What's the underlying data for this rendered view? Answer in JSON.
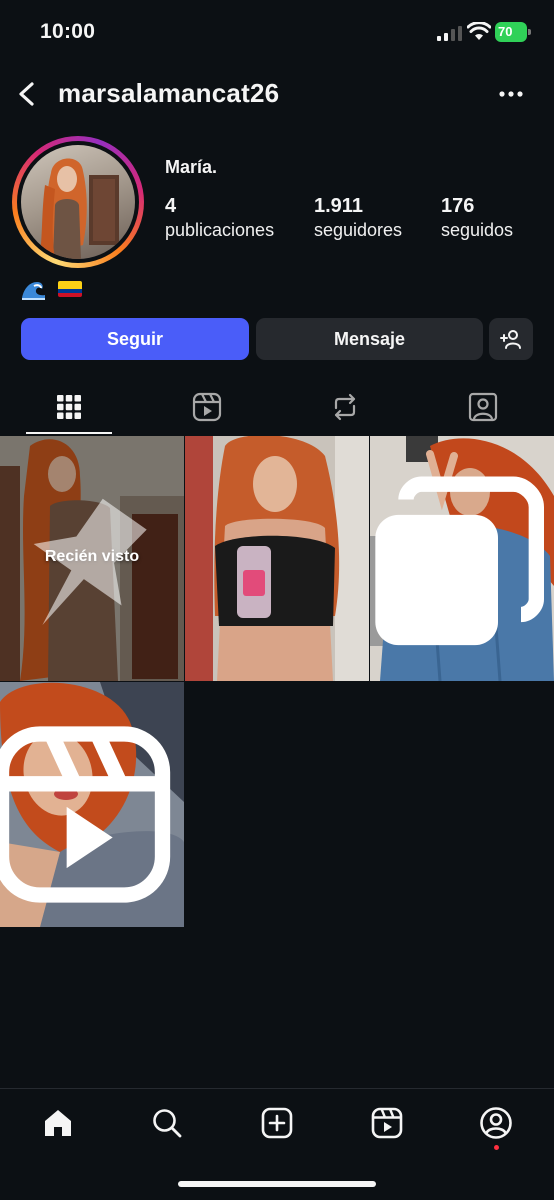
{
  "status_bar": {
    "time": "10:00",
    "battery": "70"
  },
  "header": {
    "username": "marsalamancat26"
  },
  "profile": {
    "display_name": "María.",
    "stats": {
      "posts": {
        "value": "4",
        "label": "publicaciones"
      },
      "followers": {
        "value": "1.911",
        "label": "seguidores"
      },
      "following": {
        "value": "176",
        "label": "seguidos"
      }
    },
    "bio_icons": [
      "wave-emoji",
      "colombia-flag"
    ]
  },
  "actions": {
    "follow_label": "Seguir",
    "message_label": "Mensaje"
  },
  "tabs": [
    "grid-icon",
    "reels-icon",
    "reposts-icon",
    "tagged-icon"
  ],
  "grid": {
    "posts": [
      {
        "overlay": "Recién visto",
        "badge": "pin-icon"
      },
      {
        "overlay": "",
        "badge": ""
      },
      {
        "overlay": "",
        "badge": "carousel-icon"
      },
      {
        "overlay": "",
        "badge": "reel-icon"
      }
    ]
  },
  "bottom_nav": [
    "home-icon",
    "search-icon",
    "create-icon",
    "reels-icon",
    "profile-icon"
  ],
  "colors": {
    "background": "#0c1014",
    "follow_button": "#4a5df9",
    "secondary_button": "#26292e",
    "battery": "#30d158",
    "notification": "#ff3040"
  }
}
